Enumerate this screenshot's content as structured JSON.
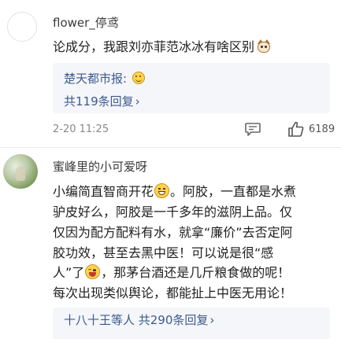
{
  "comments": [
    {
      "username": "flower_停鸢",
      "text": "论成分，我跟刘亦菲范冰冰有啥区别",
      "text_emoji_icon": "cat-face-icon",
      "reply": {
        "author": "楚天都市报:",
        "author_emoji_icon": "smiling-face-icon",
        "count_text": "共119条回复",
        "chevron_icon": "chevron-right-icon"
      },
      "timestamp": "2-20 11:25",
      "like_count": "6189"
    },
    {
      "username": "蜜峰里的小可爱呀",
      "lines": [
        {
          "before": "小编简直智商开花",
          "after": "。阿胶，一直都是水煮"
        },
        {
          "text": "驴皮好么，阿胶是一千多年的滋阴上品。仅"
        },
        {
          "text": "仅因为配方配料有水，就拿“廉价”去否定阿"
        },
        {
          "text": "胶功效，甚至去黑中医！可以说是很“感"
        },
        {
          "before": "人”了",
          "after": "，那茅台酒还是几斤粮食做的呢！"
        },
        {
          "text": "每次出现类似舆论，都能扯上中医无用论！"
        }
      ],
      "line1_emoji_icon": "grinning-face-icon",
      "line5_emoji_icon": "laughing-face-icon",
      "reply": {
        "count_text": "十八十王等人 共290条回复",
        "chevron_icon": "chevron-right-icon"
      }
    }
  ],
  "icons": {
    "comment": "comment-bubble-icon",
    "like": "thumbs-up-icon"
  },
  "colors": {
    "link_blue": "#3d5a8c",
    "reply_bg": "#f4f6f9",
    "meta_gray": "#888888"
  }
}
